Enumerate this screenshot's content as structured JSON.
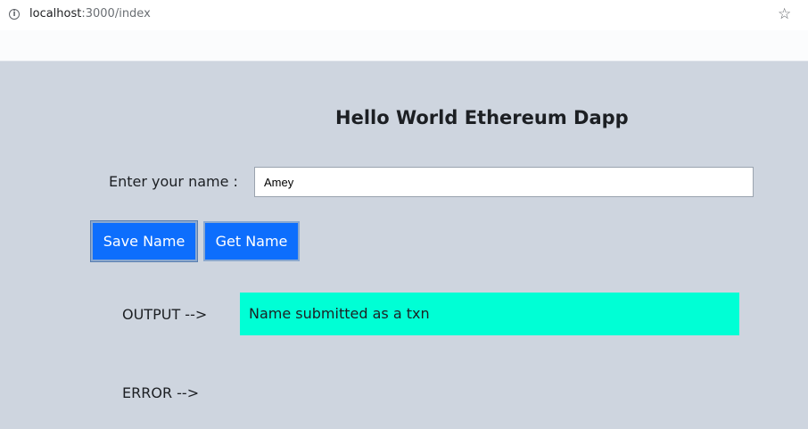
{
  "browser": {
    "url_host": "localhost",
    "url_rest": ":3000/index"
  },
  "page": {
    "title": "Hello World Ethereum Dapp",
    "name_label": "Enter your name :",
    "name_value": "Amey",
    "save_button": "Save Name",
    "get_button": "Get Name",
    "output_label": "OUTPUT -->",
    "output_value": "Name submitted as a txn",
    "error_label": "ERROR -->"
  },
  "colors": {
    "page_background": "#ced5df",
    "button": "#0d6efd",
    "output_background": "#00ffd5"
  },
  "icons": {
    "site_info": "info-icon",
    "bookmark": "star-icon"
  }
}
